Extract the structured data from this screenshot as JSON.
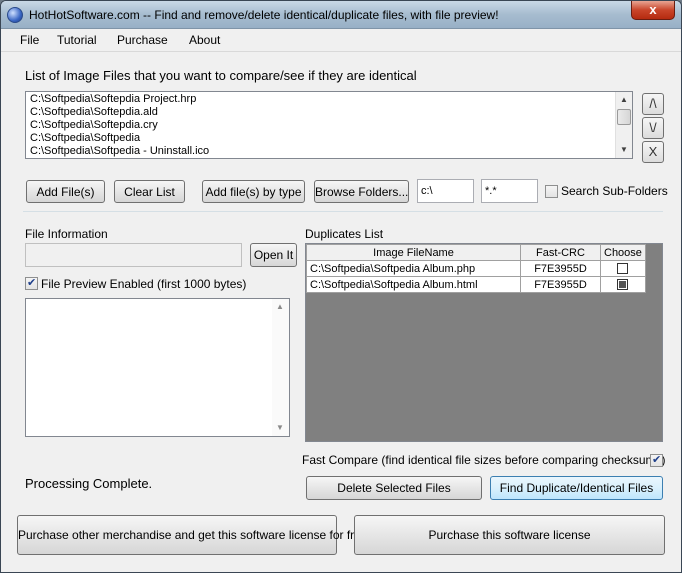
{
  "window": {
    "title": "HotHotSoftware.com -- Find and remove/delete identical/duplicate files, with file preview!",
    "close_glyph": "x"
  },
  "menu": [
    {
      "label": "File"
    },
    {
      "label": "Tutorial"
    },
    {
      "label": "Purchase"
    },
    {
      "label": "About"
    }
  ],
  "files_section": {
    "label": "List of Image Files that you want to compare/see if they are identical",
    "files": [
      "C:\\Softpedia\\Softepdia Project.hrp",
      "C:\\Softpedia\\Softepdia.ald",
      "C:\\Softpedia\\Softepdia.cry",
      "C:\\Softpedia\\Softpedia",
      "C:\\Softpedia\\Softpedia - Uninstall.ico"
    ],
    "move_up": "/\\",
    "move_down": "\\/",
    "remove": "X"
  },
  "toolbar": {
    "add_files": "Add File(s)",
    "clear_list": "Clear List",
    "add_by_type": "Add file(s) by type",
    "browse_folders": "Browse Folders...",
    "folder_value": "c:\\",
    "pattern_value": "*.*",
    "search_subfolders": "Search Sub-Folders",
    "search_subfolders_checked": false
  },
  "file_info": {
    "label": "File Information",
    "path_value": "",
    "open_it": "Open It",
    "preview_label": "File Preview Enabled (first 1000 bytes)",
    "preview_checked": true,
    "preview_text": ""
  },
  "duplicates": {
    "label": "Duplicates List",
    "columns": [
      "Image FileName",
      "Fast-CRC",
      "Choose"
    ],
    "rows": [
      {
        "file": "C:\\Softpedia\\Softpedia Album.php",
        "crc": "F7E3955D",
        "choose": "unchecked"
      },
      {
        "file": "C:\\Softpedia\\Softpedia Album.html",
        "crc": "F7E3955D",
        "choose": "indeterminate"
      }
    ]
  },
  "fast_compare": {
    "label": "Fast Compare (find identical file sizes before comparing checksums)",
    "checked": true
  },
  "status": "Processing Complete.",
  "actions": {
    "delete_selected": "Delete Selected Files",
    "find_duplicates": "Find Duplicate/Identical Files"
  },
  "purchase": {
    "merch": "Purchase other merchandise and get this software license for free",
    "license": "Purchase this software license"
  }
}
